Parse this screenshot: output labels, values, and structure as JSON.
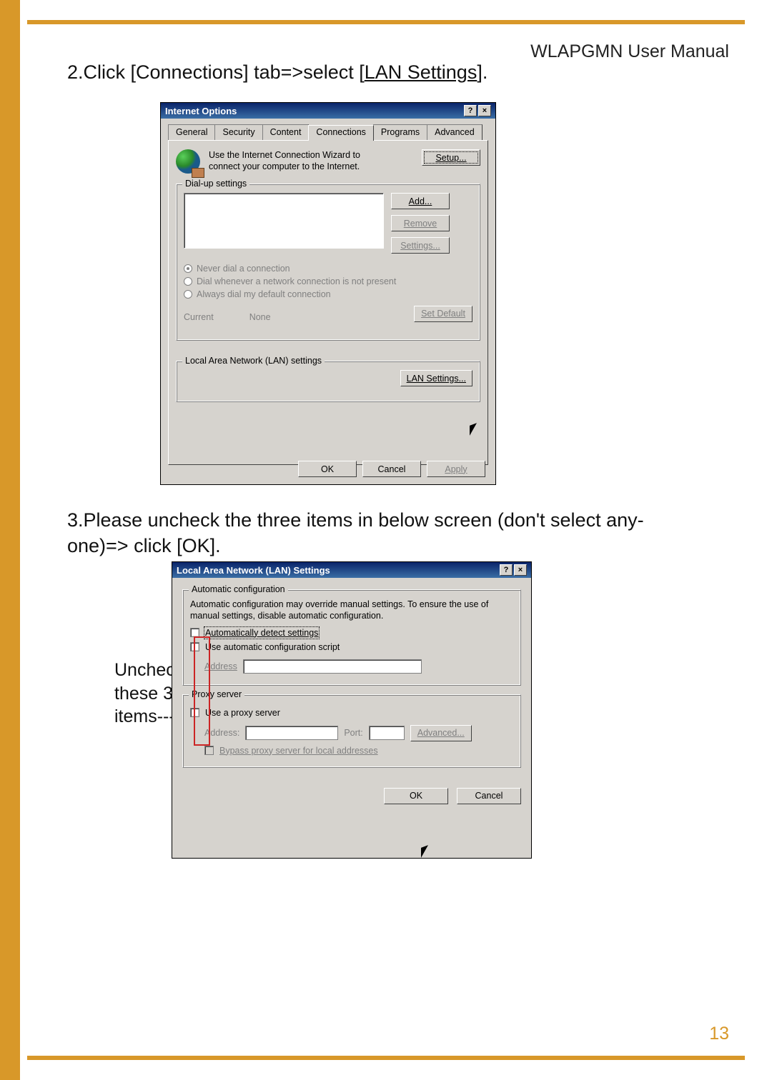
{
  "page": {
    "header": "WLAPGMN User Manual",
    "number": "13"
  },
  "instructions": {
    "step2_num": "2.",
    "step2_text_a": "Click [Connections] tab=>select [",
    "step2_text_b": "LAN Settings",
    "step2_text_c": "].",
    "step3_num": "3.",
    "step3_text": "Please uncheck the three items in below screen (don't select any-one)=> click [OK].",
    "side_line1": "Uncheck",
    "side_line2": "these 3",
    "side_line3": "items---->"
  },
  "dialog1": {
    "title": "Internet Options",
    "help_btn": "?",
    "close_btn": "×",
    "tabs": [
      "General",
      "Security",
      "Content",
      "Connections",
      "Programs",
      "Advanced"
    ],
    "wizard_line1": "Use the Internet Connection Wizard to",
    "wizard_line2": "connect your computer to the Internet.",
    "setup_btn": "Setup...",
    "dialup_legend": "Dial-up settings",
    "add_btn": "Add...",
    "remove_btn": "Remove",
    "settings_btn": "Settings...",
    "radio1": "Never dial a connection",
    "radio2": "Dial whenever a network connection is not present",
    "radio3": "Always dial my default connection",
    "current_lbl": "Current",
    "current_val": "None",
    "setdefault_btn": "Set Default",
    "lan_legend": "Local Area Network (LAN) settings",
    "lan_btn": "LAN Settings...",
    "ok_btn": "OK",
    "cancel_btn": "Cancel",
    "apply_btn": "Apply"
  },
  "dialog2": {
    "title": "Local Area Network (LAN) Settings",
    "help_btn": "?",
    "close_btn": "×",
    "auto_legend": "Automatic configuration",
    "auto_desc": "Automatic configuration may override manual settings.  To ensure the use of manual settings, disable automatic configuration.",
    "auto_detect": "Automatically detect settings",
    "auto_script": "Use automatic configuration script",
    "address_lbl": "Address",
    "proxy_legend": "Proxy server",
    "use_proxy": "Use a proxy server",
    "addr_lbl": "Address:",
    "port_lbl": "Port:",
    "advanced_btn": "Advanced...",
    "bypass": "Bypass proxy server for local addresses",
    "ok_btn": "OK",
    "cancel_btn": "Cancel"
  }
}
